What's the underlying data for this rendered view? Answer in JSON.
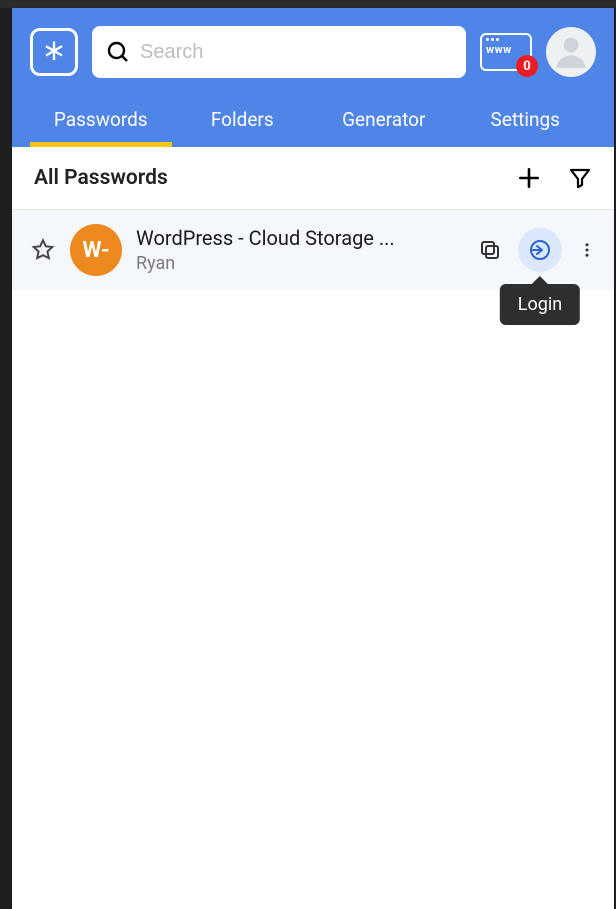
{
  "header": {
    "search_placeholder": "Search",
    "www_label": "www",
    "notification_count": "0"
  },
  "tabs": [
    {
      "label": "Passwords",
      "active": true
    },
    {
      "label": "Folders",
      "active": false
    },
    {
      "label": "Generator",
      "active": false
    },
    {
      "label": "Settings",
      "active": false
    }
  ],
  "section": {
    "title": "All Passwords"
  },
  "items": [
    {
      "avatar_text": "W-",
      "title": "WordPress - Cloud Storage ...",
      "subtitle": "Ryan"
    }
  ],
  "tooltip": {
    "login": "Login"
  }
}
